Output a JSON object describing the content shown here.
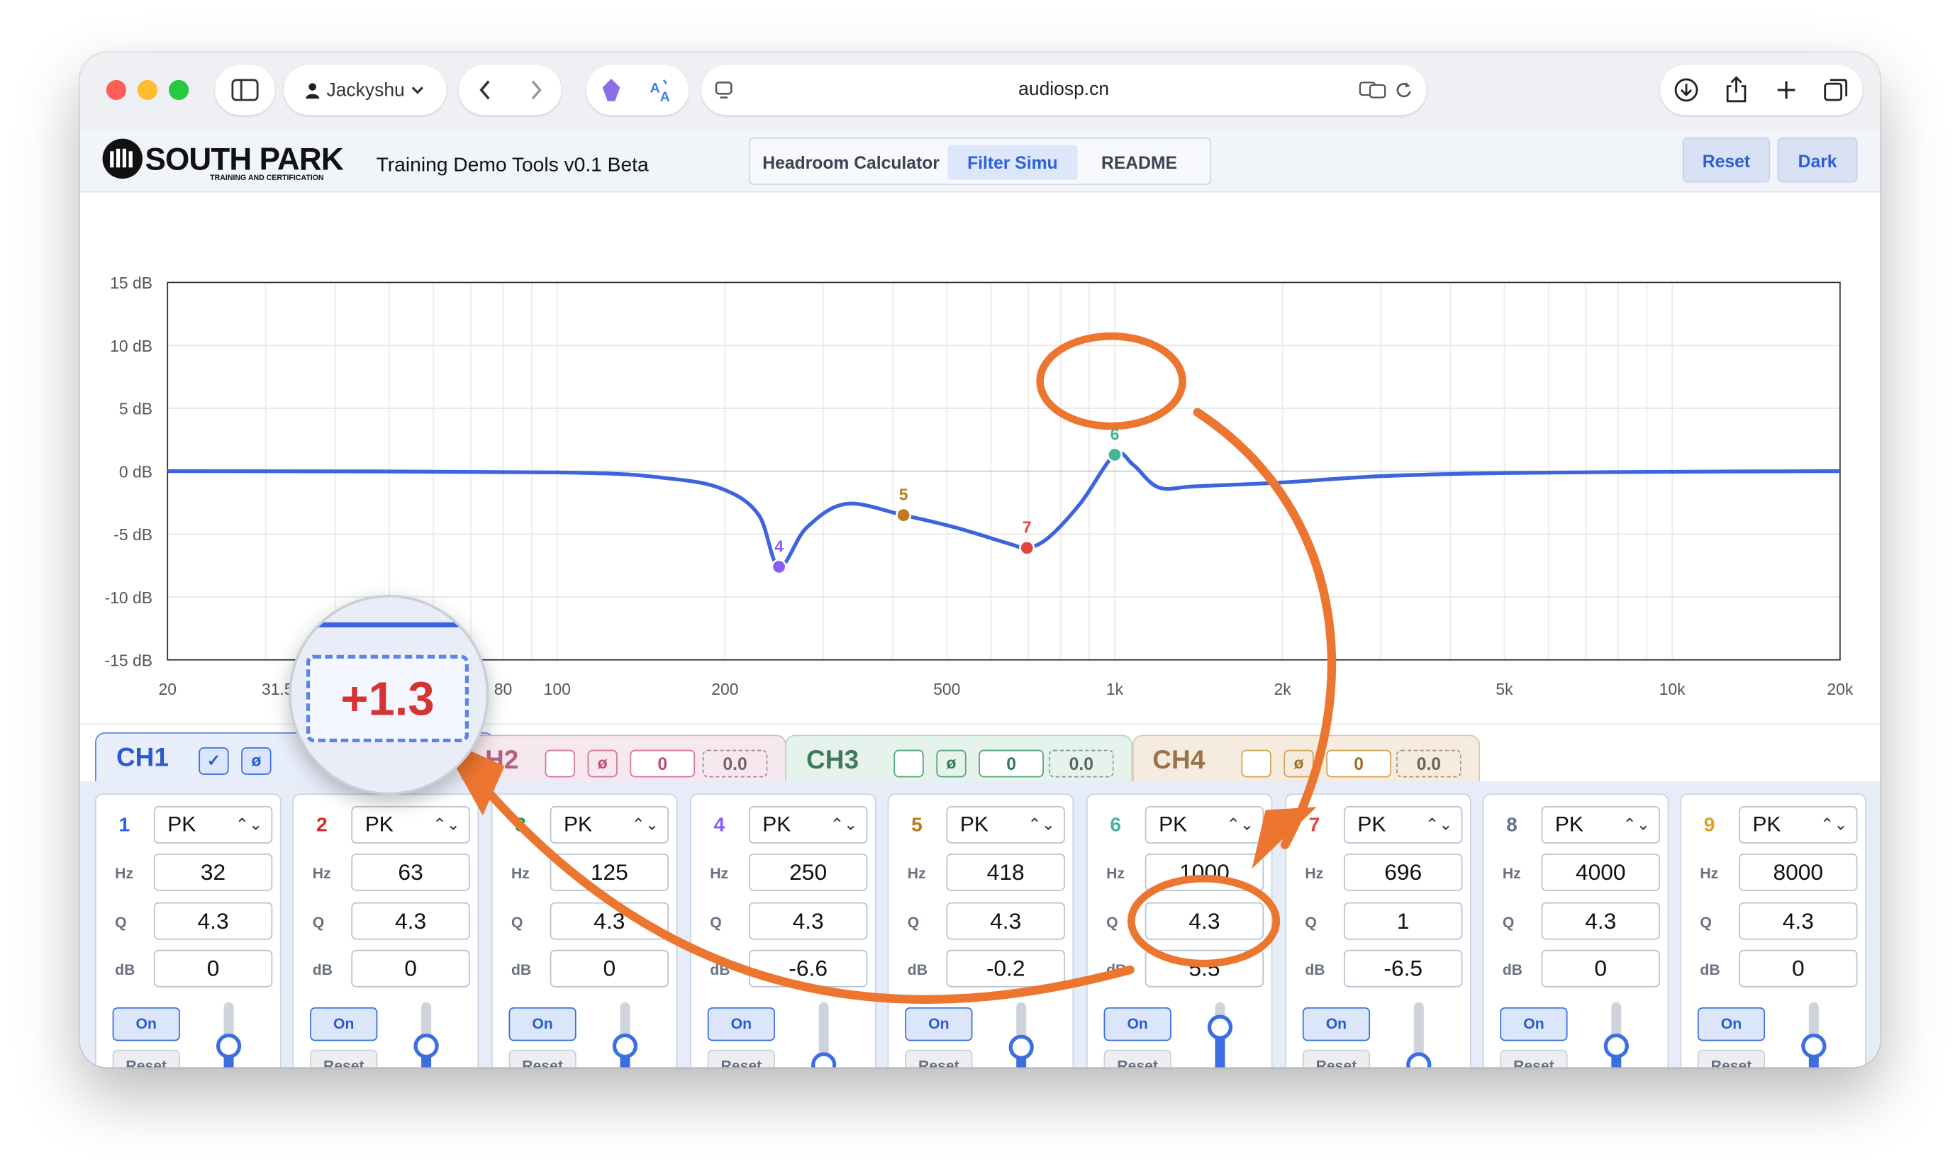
{
  "browser": {
    "profile": "Jackyshu",
    "url": "audiosp.cn"
  },
  "header": {
    "brand": "SOUTH PARK",
    "brand_sub": "TRAINING AND CERTIFICATION",
    "app_title": "Training Demo Tools v0.1 Beta",
    "tabs": [
      {
        "label": "Headroom Calculator",
        "active": false
      },
      {
        "label": "Filter Simu",
        "active": true
      },
      {
        "label": "README",
        "active": false
      }
    ],
    "reset_label": "Reset",
    "dark_label": "Dark"
  },
  "chart_data": {
    "type": "line",
    "x_scale": "log",
    "x_range": [
      20,
      20000
    ],
    "y_range": [
      -15,
      15
    ],
    "x_ticks": [
      {
        "v": 20,
        "label": "20"
      },
      {
        "v": 31.5,
        "label": "31.5"
      },
      {
        "v": 80,
        "label": "80"
      },
      {
        "v": 100,
        "label": "100"
      },
      {
        "v": 200,
        "label": "200"
      },
      {
        "v": 500,
        "label": "500"
      },
      {
        "v": 1000,
        "label": "1k"
      },
      {
        "v": 2000,
        "label": "2k"
      },
      {
        "v": 5000,
        "label": "5k"
      },
      {
        "v": 10000,
        "label": "10k"
      },
      {
        "v": 20000,
        "label": "20k"
      }
    ],
    "y_ticks": [
      {
        "v": 15,
        "label": "15 dB"
      },
      {
        "v": 10,
        "label": "10 dB"
      },
      {
        "v": 5,
        "label": "5 dB"
      },
      {
        "v": 0,
        "label": "0 dB"
      },
      {
        "v": -5,
        "label": "-5 dB"
      },
      {
        "v": -10,
        "label": "-10 dB"
      },
      {
        "v": -15,
        "label": "-15 dB"
      }
    ],
    "grid": true,
    "curve_color": "#3d63dd",
    "response": [
      [
        20,
        0
      ],
      [
        100,
        -0.1
      ],
      [
        160,
        -0.6
      ],
      [
        200,
        -1.5
      ],
      [
        230,
        -3.5
      ],
      [
        250,
        -7.6
      ],
      [
        280,
        -4.5
      ],
      [
        330,
        -2.6
      ],
      [
        418,
        -3.5
      ],
      [
        520,
        -4.5
      ],
      [
        650,
        -5.8
      ],
      [
        696,
        -6.1
      ],
      [
        760,
        -5.3
      ],
      [
        870,
        -2.5
      ],
      [
        1000,
        1.3
      ],
      [
        1080,
        0.5
      ],
      [
        1200,
        -1.3
      ],
      [
        1400,
        -1.2
      ],
      [
        2000,
        -0.9
      ],
      [
        3000,
        -0.4
      ],
      [
        5000,
        -0.15
      ],
      [
        10000,
        -0.05
      ],
      [
        20000,
        0
      ]
    ],
    "markers": [
      {
        "label": "4",
        "x": 250,
        "y": -7.6,
        "color": "#8b5cf6"
      },
      {
        "label": "5",
        "x": 418,
        "y": -3.5,
        "color": "#c0791f"
      },
      {
        "label": "7",
        "x": 696,
        "y": -6.1,
        "color": "#e04444"
      },
      {
        "label": "6",
        "x": 1000,
        "y": 1.3,
        "color": "#3fb59a"
      }
    ]
  },
  "channels": [
    {
      "label": "CH1",
      "check": "✓",
      "phase": "ø"
    },
    {
      "label": "H2",
      "phase": "ø",
      "gain": "0",
      "value": "0.0"
    },
    {
      "label": "CH3",
      "phase": "ø",
      "gain": "0",
      "value": "0.0"
    },
    {
      "label": "CH4",
      "phase": "ø",
      "gain": "0",
      "value": "0.0"
    }
  ],
  "field_labels": {
    "hz": "Hz",
    "q": "Q",
    "db": "dB"
  },
  "bands": [
    {
      "num": "1",
      "type": "PK",
      "hz": "32",
      "q": "4.3",
      "db": "0",
      "on": "On",
      "reset": "Reset",
      "color": "#2563eb",
      "level": 0.5
    },
    {
      "num": "2",
      "type": "PK",
      "hz": "63",
      "q": "4.3",
      "db": "0",
      "on": "On",
      "reset": "Reset",
      "color": "#dc2626",
      "level": 0.5
    },
    {
      "num": "3",
      "type": "PK",
      "hz": "125",
      "q": "4.3",
      "db": "0",
      "on": "On",
      "reset": "Reset",
      "color": "#16a34a",
      "level": 0.5
    },
    {
      "num": "4",
      "type": "PK",
      "hz": "250",
      "q": "4.3",
      "db": "-6.6",
      "on": "On",
      "reset": "Reset",
      "color": "#8b5cf6",
      "level": 0.28
    },
    {
      "num": "5",
      "type": "PK",
      "hz": "418",
      "q": "4.3",
      "db": "-0.2",
      "on": "On",
      "reset": "Reset",
      "color": "#c0791f",
      "level": 0.49
    },
    {
      "num": "6",
      "type": "PK",
      "hz": "1000",
      "q": "4.3",
      "db": "5.5",
      "on": "On",
      "reset": "Reset",
      "color": "#3fb59a",
      "level": 0.72
    },
    {
      "num": "7",
      "type": "PK",
      "hz": "696",
      "q": "1",
      "db": "-6.5",
      "on": "On",
      "reset": "Reset",
      "color": "#e04444",
      "level": 0.28
    },
    {
      "num": "8",
      "type": "PK",
      "hz": "4000",
      "q": "4.3",
      "db": "0",
      "on": "On",
      "reset": "Reset",
      "color": "#64748b",
      "level": 0.5
    },
    {
      "num": "9",
      "type": "PK",
      "hz": "8000",
      "q": "4.3",
      "db": "0",
      "on": "On",
      "reset": "Reset",
      "color": "#e0a020",
      "level": 0.5
    }
  ],
  "magnifier_value": "+1.3",
  "annotation_color": "#ec7630"
}
